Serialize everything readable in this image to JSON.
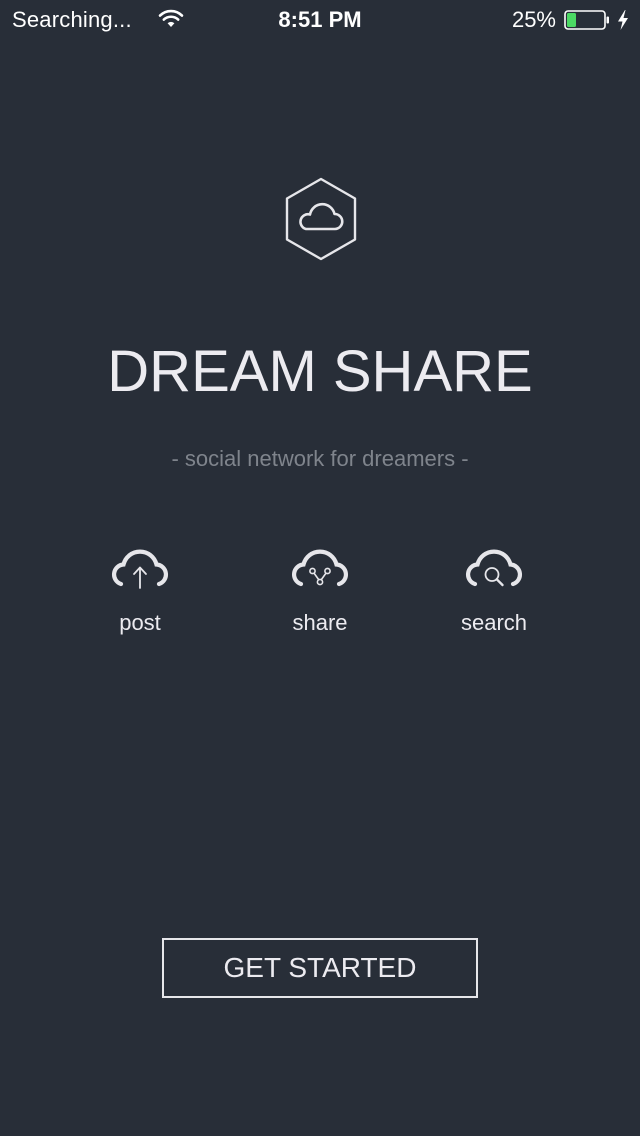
{
  "status_bar": {
    "carrier": "Searching...",
    "time": "8:51 PM",
    "battery_percent": "25%",
    "battery_level": 0.25,
    "battery_color": "#4cd964",
    "icons": [
      "wifi-icon",
      "battery-icon",
      "charging-bolt-icon"
    ]
  },
  "logo": {
    "icon": "cloud-hexagon-logo-icon"
  },
  "app": {
    "title": "DREAM SHARE",
    "tagline": "- social network for dreamers -"
  },
  "features": [
    {
      "label": "post",
      "icon": "cloud-upload-icon"
    },
    {
      "label": "share",
      "icon": "cloud-share-icon"
    },
    {
      "label": "search",
      "icon": "cloud-search-icon"
    }
  ],
  "cta": {
    "label": "GET STARTED"
  },
  "colors": {
    "background": "#282e38",
    "text": "#ecebf0",
    "muted": "#7f848c"
  }
}
